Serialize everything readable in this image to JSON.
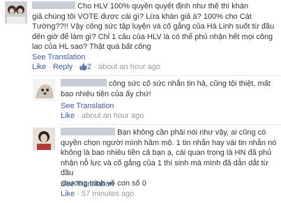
{
  "comments": [
    {
      "text": "Cho HLV 100% quyền quyết định như thế thì khán giả chúng tôi VOTE được cái gì? Lừa khán giả à? 100% cho Cát Tường??!! Vậy công sức tập luyện và cố gắng của Hà Linh suốt từ đầu đến giờ để làm gì? Chỉ 1 câu của HLV là có thể phủ nhận hết mọi công lao của HL sao? Thật quá bất công",
      "lines": [
        "Cho HLV 100% quyền quyết định như thế thì khán",
        "giả chúng tôi VOTE được cái gì? Lừa khán giả à? 100% cho Cát",
        "Tường??!! Vậy công sức tập luyện và cố gắng của Hà Linh suốt từ đầu",
        "đến giờ để làm gì? Chỉ 1 câu của HLV là có thể phủ nhận hết mọi công",
        "lao của HL sao? Thật quá bất công"
      ],
      "see_translation": "See Translation",
      "like": "Like",
      "reply": "Reply",
      "like_count": "2",
      "time": "about an hour ago"
    },
    {
      "lines": [
        "công sức cố sức nhắn tin hả, cũng tội thiệt, mất",
        "bao nhiêu tiền của ấy chứ!"
      ],
      "see_translation": "See Translation",
      "like": "Like",
      "time": "about an hour ago"
    },
    {
      "lines": [
        "Bạn không cần phải nói như vậy, ai cũng có",
        "quyền chọn người mình hâm mộ. 1 tin nhắn hay vài tin nhắn nó",
        "không là bao nhiêu tiền cả bạn ạ, cái quan trọng là HN đã phủ",
        "nhận nỗ lực và cố gắng của 1 thí sinh mà mình đã dẫn dắt từ đầu",
        "chương trình về con số 0"
      ],
      "see_translation": "See Translation",
      "like": "Like",
      "time": "57 minutes ago"
    }
  ],
  "separator": "·",
  "colors": {
    "link": "#3b5998",
    "meta": "#999999",
    "text": "#333333"
  }
}
